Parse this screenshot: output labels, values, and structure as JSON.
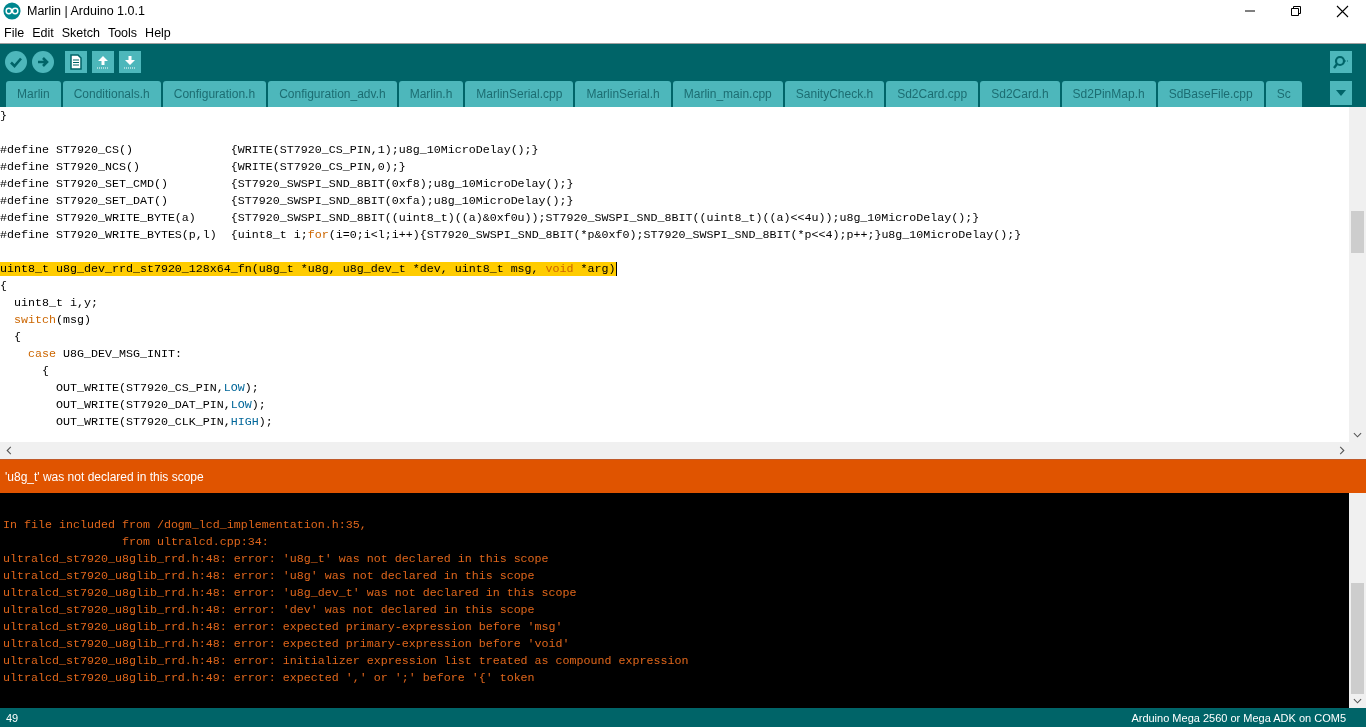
{
  "window": {
    "title": "Marlin | Arduino 1.0.1"
  },
  "menu": [
    "File",
    "Edit",
    "Sketch",
    "Tools",
    "Help"
  ],
  "tabs": [
    {
      "label": "Marlin",
      "selected": false
    },
    {
      "label": "Conditionals.h",
      "selected": false
    },
    {
      "label": "Configuration.h",
      "selected": false
    },
    {
      "label": "Configuration_adv.h",
      "selected": false
    },
    {
      "label": "Marlin.h",
      "selected": false
    },
    {
      "label": "MarlinSerial.cpp",
      "selected": false
    },
    {
      "label": "MarlinSerial.h",
      "selected": false
    },
    {
      "label": "Marlin_main.cpp",
      "selected": false
    },
    {
      "label": "SanityCheck.h",
      "selected": false
    },
    {
      "label": "Sd2Card.cpp",
      "selected": false
    },
    {
      "label": "Sd2Card.h",
      "selected": false
    },
    {
      "label": "Sd2PinMap.h",
      "selected": false
    },
    {
      "label": "SdBaseFile.cpp",
      "selected": false
    },
    {
      "label": "Sc",
      "selected": false
    }
  ],
  "code": [
    {
      "highlighted": false,
      "segments": [
        {
          "kind": "text",
          "text": "}"
        }
      ]
    },
    {
      "highlighted": false
    },
    {
      "highlighted": false,
      "segments": [
        {
          "kind": "text",
          "text": "#define ST7920_CS()              {WRITE(ST7920_CS_PIN,1);u8g_10MicroDelay();}"
        }
      ]
    },
    {
      "highlighted": false,
      "segments": [
        {
          "kind": "text",
          "text": "#define ST7920_NCS()             {WRITE(ST7920_CS_PIN,0);}"
        }
      ]
    },
    {
      "highlighted": false,
      "segments": [
        {
          "kind": "text",
          "text": "#define ST7920_SET_CMD()         {ST7920_SWSPI_SND_8BIT(0xf8);u8g_10MicroDelay();}"
        }
      ]
    },
    {
      "highlighted": false,
      "segments": [
        {
          "kind": "text",
          "text": "#define ST7920_SET_DAT()         {ST7920_SWSPI_SND_8BIT(0xfa);u8g_10MicroDelay();}"
        }
      ]
    },
    {
      "highlighted": false,
      "segments": [
        {
          "kind": "text",
          "text": "#define ST7920_WRITE_BYTE(a)     {ST7920_SWSPI_SND_8BIT((uint8_t)((a)&0xf0u));ST7920_SWSPI_SND_8BIT((uint8_t)((a)<<4u));u8g_10MicroDelay();}"
        }
      ]
    },
    {
      "highlighted": false,
      "segments": [
        {
          "kind": "text",
          "text": "#define ST7920_WRITE_BYTES(p,l)  {uint8_t i;"
        },
        {
          "kind": "keyword",
          "text": "for"
        },
        {
          "kind": "text",
          "text": "(i=0;i<l;i++){ST7920_SWSPI_SND_8BIT(*p&0xf0);ST7920_SWSPI_SND_8BIT(*p<<4);p++;}u8g_10MicroDelay();}"
        }
      ]
    },
    {
      "highlighted": false
    },
    {
      "highlighted": true,
      "segments": [
        {
          "kind": "text",
          "text": "uint8_t u8g_dev_rrd_st7920_128x64_fn(u8g_t *u8g, u8g_dev_t *dev, uint8_t msg, "
        },
        {
          "kind": "keyword",
          "text": "void"
        },
        {
          "kind": "text",
          "text": " *arg)"
        }
      ]
    },
    {
      "highlighted": false,
      "segments": [
        {
          "kind": "text",
          "text": "{"
        }
      ]
    },
    {
      "highlighted": false,
      "segments": [
        {
          "kind": "text",
          "text": "  uint8_t i,y;"
        }
      ]
    },
    {
      "highlighted": false,
      "segments": [
        {
          "kind": "keyword",
          "text": "  switch"
        },
        {
          "kind": "text",
          "text": "(msg)"
        }
      ]
    },
    {
      "highlighted": false,
      "segments": [
        {
          "kind": "text",
          "text": "  {"
        }
      ]
    },
    {
      "highlighted": false,
      "segments": [
        {
          "kind": "keyword",
          "text": "    case"
        },
        {
          "kind": "text",
          "text": " U8G_DEV_MSG_INIT:"
        }
      ]
    },
    {
      "highlighted": false,
      "segments": [
        {
          "kind": "text",
          "text": "      {"
        }
      ]
    },
    {
      "highlighted": false,
      "segments": [
        {
          "kind": "text",
          "text": "        OUT_WRITE(ST7920_CS_PIN,"
        },
        {
          "kind": "constant",
          "text": "LOW"
        },
        {
          "kind": "text",
          "text": ");"
        }
      ]
    },
    {
      "highlighted": false,
      "segments": [
        {
          "kind": "text",
          "text": "        OUT_WRITE(ST7920_DAT_PIN,"
        },
        {
          "kind": "constant",
          "text": "LOW"
        },
        {
          "kind": "text",
          "text": ");"
        }
      ]
    },
    {
      "highlighted": false,
      "segments": [
        {
          "kind": "text",
          "text": "        OUT_WRITE(ST7920_CLK_PIN,"
        },
        {
          "kind": "constant",
          "text": "HIGH"
        },
        {
          "kind": "text",
          "text": ");"
        }
      ]
    }
  ],
  "error_bar": {
    "message": "'u8g_t' was not declared in this scope"
  },
  "console": [
    "In file included from /dogm_lcd_implementation.h:35,",
    "                 from ultralcd.cpp:34:",
    "ultralcd_st7920_u8glib_rrd.h:48: error: 'u8g_t' was not declared in this scope",
    "ultralcd_st7920_u8glib_rrd.h:48: error: 'u8g' was not declared in this scope",
    "ultralcd_st7920_u8glib_rrd.h:48: error: 'u8g_dev_t' was not declared in this scope",
    "ultralcd_st7920_u8glib_rrd.h:48: error: 'dev' was not declared in this scope",
    "ultralcd_st7920_u8glib_rrd.h:48: error: expected primary-expression before 'msg'",
    "ultralcd_st7920_u8glib_rrd.h:48: error: expected primary-expression before 'void'",
    "ultralcd_st7920_u8glib_rrd.h:48: error: initializer expression list treated as compound expression",
    "ultralcd_st7920_u8glib_rrd.h:49: error: expected ',' or ';' before '{' token"
  ],
  "status_bar": {
    "line": "49",
    "board": "Arduino Mega 2560 or Mega ADK on COM5"
  }
}
